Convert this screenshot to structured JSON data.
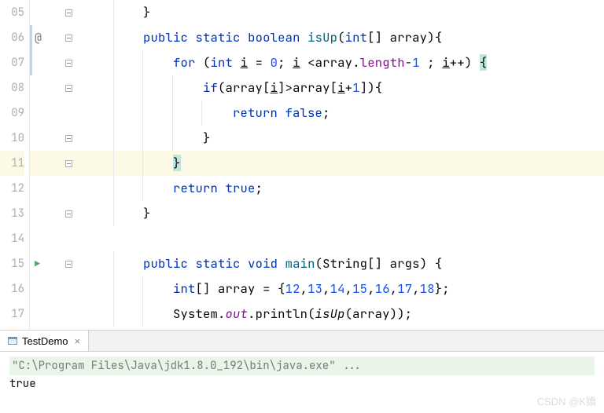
{
  "line_numbers": [
    "05",
    "06",
    "07",
    "08",
    "09",
    "10",
    "11",
    "12",
    "13",
    "14",
    "15",
    "16",
    "17"
  ],
  "highlight_line_index": 6,
  "gutter_markers": {
    "1": {
      "type": "at",
      "symbol": "@"
    },
    "10": {
      "type": "run",
      "symbol": "▶"
    }
  },
  "fold_markers": {
    "0": "minus",
    "1": "minus",
    "2": "minus",
    "3": "minus",
    "5": "minus",
    "6": "minus",
    "8": "minus",
    "10": "minus"
  },
  "code": {
    "l05": {
      "indent": "        ",
      "tokens": [
        {
          "t": "}",
          "c": "punct"
        }
      ]
    },
    "l06": {
      "indent": "        ",
      "tokens": [
        {
          "t": "public",
          "c": "kw"
        },
        {
          "t": " "
        },
        {
          "t": "static",
          "c": "kw"
        },
        {
          "t": " "
        },
        {
          "t": "boolean",
          "c": "ty"
        },
        {
          "t": " "
        },
        {
          "t": "isUp",
          "c": "mname"
        },
        {
          "t": "(",
          "c": "punct"
        },
        {
          "t": "int",
          "c": "ty"
        },
        {
          "t": "[] ",
          "c": "punct"
        },
        {
          "t": "array",
          "c": "plain"
        },
        {
          "t": "){",
          "c": "punct"
        }
      ]
    },
    "l07": {
      "indent": "            ",
      "tokens": [
        {
          "t": "for",
          "c": "kw"
        },
        {
          "t": " (",
          "c": "punct"
        },
        {
          "t": "int",
          "c": "ty"
        },
        {
          "t": " "
        },
        {
          "t": "i",
          "c": "plain underline"
        },
        {
          "t": " = ",
          "c": "op"
        },
        {
          "t": "0",
          "c": "num"
        },
        {
          "t": "; ",
          "c": "punct"
        },
        {
          "t": "i",
          "c": "plain underline"
        },
        {
          "t": " <",
          "c": "op"
        },
        {
          "t": "array",
          "c": "plain"
        },
        {
          "t": ".",
          "c": "punct"
        },
        {
          "t": "length",
          "c": "fld"
        },
        {
          "t": "-",
          "c": "op"
        },
        {
          "t": "1",
          "c": "num"
        },
        {
          "t": " ; ",
          "c": "punct"
        },
        {
          "t": "i",
          "c": "plain underline"
        },
        {
          "t": "++) ",
          "c": "op"
        },
        {
          "t": "{",
          "c": "punct hl-cursor"
        }
      ]
    },
    "l08": {
      "indent": "                ",
      "tokens": [
        {
          "t": "if",
          "c": "kw"
        },
        {
          "t": "(",
          "c": "punct"
        },
        {
          "t": "array",
          "c": "plain"
        },
        {
          "t": "[",
          "c": "punct"
        },
        {
          "t": "i",
          "c": "plain underline"
        },
        {
          "t": "]>",
          "c": "op"
        },
        {
          "t": "array",
          "c": "plain"
        },
        {
          "t": "[",
          "c": "punct"
        },
        {
          "t": "i",
          "c": "plain underline"
        },
        {
          "t": "+",
          "c": "op"
        },
        {
          "t": "1",
          "c": "num"
        },
        {
          "t": "]){",
          "c": "punct"
        }
      ]
    },
    "l09": {
      "indent": "                    ",
      "tokens": [
        {
          "t": "return",
          "c": "kw"
        },
        {
          "t": " "
        },
        {
          "t": "false",
          "c": "kw"
        },
        {
          "t": ";",
          "c": "punct"
        }
      ]
    },
    "l10": {
      "indent": "                ",
      "tokens": [
        {
          "t": "}",
          "c": "punct"
        }
      ]
    },
    "l11": {
      "indent": "            ",
      "tokens": [
        {
          "t": "}",
          "c": "punct hl-cursor"
        }
      ]
    },
    "l12": {
      "indent": "            ",
      "tokens": [
        {
          "t": "return",
          "c": "kw"
        },
        {
          "t": " "
        },
        {
          "t": "true",
          "c": "kw"
        },
        {
          "t": ";",
          "c": "punct"
        }
      ]
    },
    "l13": {
      "indent": "        ",
      "tokens": [
        {
          "t": "}",
          "c": "punct"
        }
      ]
    },
    "l14": {
      "indent": "",
      "tokens": []
    },
    "l15": {
      "indent": "        ",
      "tokens": [
        {
          "t": "public",
          "c": "kw"
        },
        {
          "t": " "
        },
        {
          "t": "static",
          "c": "kw"
        },
        {
          "t": " "
        },
        {
          "t": "void",
          "c": "ty"
        },
        {
          "t": " "
        },
        {
          "t": "main",
          "c": "mname"
        },
        {
          "t": "(",
          "c": "punct"
        },
        {
          "t": "String",
          "c": "plain"
        },
        {
          "t": "[] ",
          "c": "punct"
        },
        {
          "t": "args",
          "c": "plain"
        },
        {
          "t": ") {",
          "c": "punct"
        }
      ]
    },
    "l16": {
      "indent": "            ",
      "tokens": [
        {
          "t": "int",
          "c": "ty"
        },
        {
          "t": "[] ",
          "c": "punct"
        },
        {
          "t": "array",
          "c": "plain"
        },
        {
          "t": " = {",
          "c": "punct"
        },
        {
          "t": "12",
          "c": "num"
        },
        {
          "t": ",",
          "c": "punct"
        },
        {
          "t": "13",
          "c": "num"
        },
        {
          "t": ",",
          "c": "punct"
        },
        {
          "t": "14",
          "c": "num"
        },
        {
          "t": ",",
          "c": "punct"
        },
        {
          "t": "15",
          "c": "num"
        },
        {
          "t": ",",
          "c": "punct"
        },
        {
          "t": "16",
          "c": "num"
        },
        {
          "t": ",",
          "c": "punct"
        },
        {
          "t": "17",
          "c": "num"
        },
        {
          "t": ",",
          "c": "punct"
        },
        {
          "t": "18",
          "c": "num"
        },
        {
          "t": "};",
          "c": "punct"
        }
      ]
    },
    "l17": {
      "indent": "            ",
      "tokens": [
        {
          "t": "System",
          "c": "plain"
        },
        {
          "t": ".",
          "c": "punct"
        },
        {
          "t": "out",
          "c": "fld italic"
        },
        {
          "t": ".",
          "c": "punct"
        },
        {
          "t": "println",
          "c": "plain"
        },
        {
          "t": "(",
          "c": "punct"
        },
        {
          "t": "isUp",
          "c": "plain italic"
        },
        {
          "t": "(",
          "c": "punct"
        },
        {
          "t": "array",
          "c": "plain"
        },
        {
          "t": "));",
          "c": "punct"
        }
      ]
    }
  },
  "change_bars": [
    {
      "top_line": 1,
      "height_lines": 2
    }
  ],
  "panel": {
    "tab_label": "TestDemo",
    "close_symbol": "×",
    "command_line": "\"C:\\Program Files\\Java\\jdk1.8.0_192\\bin\\java.exe\" ...",
    "output": "true"
  },
  "watermark": "CSDN @K嬌"
}
